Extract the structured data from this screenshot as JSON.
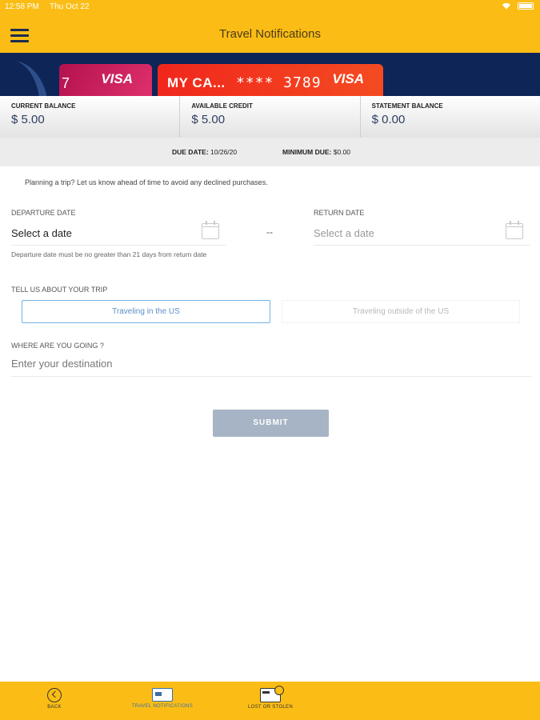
{
  "status_bar": {
    "time": "12:58 PM",
    "day": "Thu Oct 22"
  },
  "header": {
    "title": "Travel Notifications"
  },
  "cards": {
    "card1": {
      "number_fragment": "7",
      "network": "VISA"
    },
    "card2": {
      "name": "MY CA...",
      "masked_number": "**** 3789",
      "network": "VISA"
    }
  },
  "balances": [
    {
      "label": "CURRENT BALANCE",
      "value": "$ 5.00"
    },
    {
      "label": "AVAILABLE CREDIT",
      "value": "$ 5.00"
    },
    {
      "label": "STATEMENT BALANCE",
      "value": "$ 0.00"
    }
  ],
  "due": {
    "due_date_label": "DUE DATE:",
    "due_date": "10/26/20",
    "min_due_label": "MINIMUM DUE:",
    "min_due": "$0.00"
  },
  "intro": "Planning a trip? Let us know ahead of time to avoid any declined purchases.",
  "departure": {
    "label": "DEPARTURE DATE",
    "placeholder": "Select a date"
  },
  "return": {
    "label": "RETURN DATE",
    "placeholder": "Select a date"
  },
  "separator": "--",
  "date_hint": "Departure date must be no greater than 21 days from return date",
  "trip": {
    "label": "TELL US ABOUT YOUR TRIP",
    "option_us": "Traveling in the US",
    "option_outside": "Traveling outside of the US"
  },
  "destination": {
    "label": "WHERE ARE YOU GOING ?",
    "placeholder": "Enter your destination"
  },
  "submit_label": "SUBMIT",
  "bottom_nav": [
    {
      "label": "BACK",
      "icon": "back-icon"
    },
    {
      "label": "TRAVEL NOTIFICATIONS",
      "icon": "travel-notifications-icon"
    },
    {
      "label": "LOST OR STOLEN",
      "icon": "lost-or-stolen-icon"
    }
  ],
  "colors": {
    "brand_yellow": "#fbbd15",
    "navy": "#0e2558",
    "accent_blue": "#5b8fc7",
    "card_red": "#f0271c"
  }
}
